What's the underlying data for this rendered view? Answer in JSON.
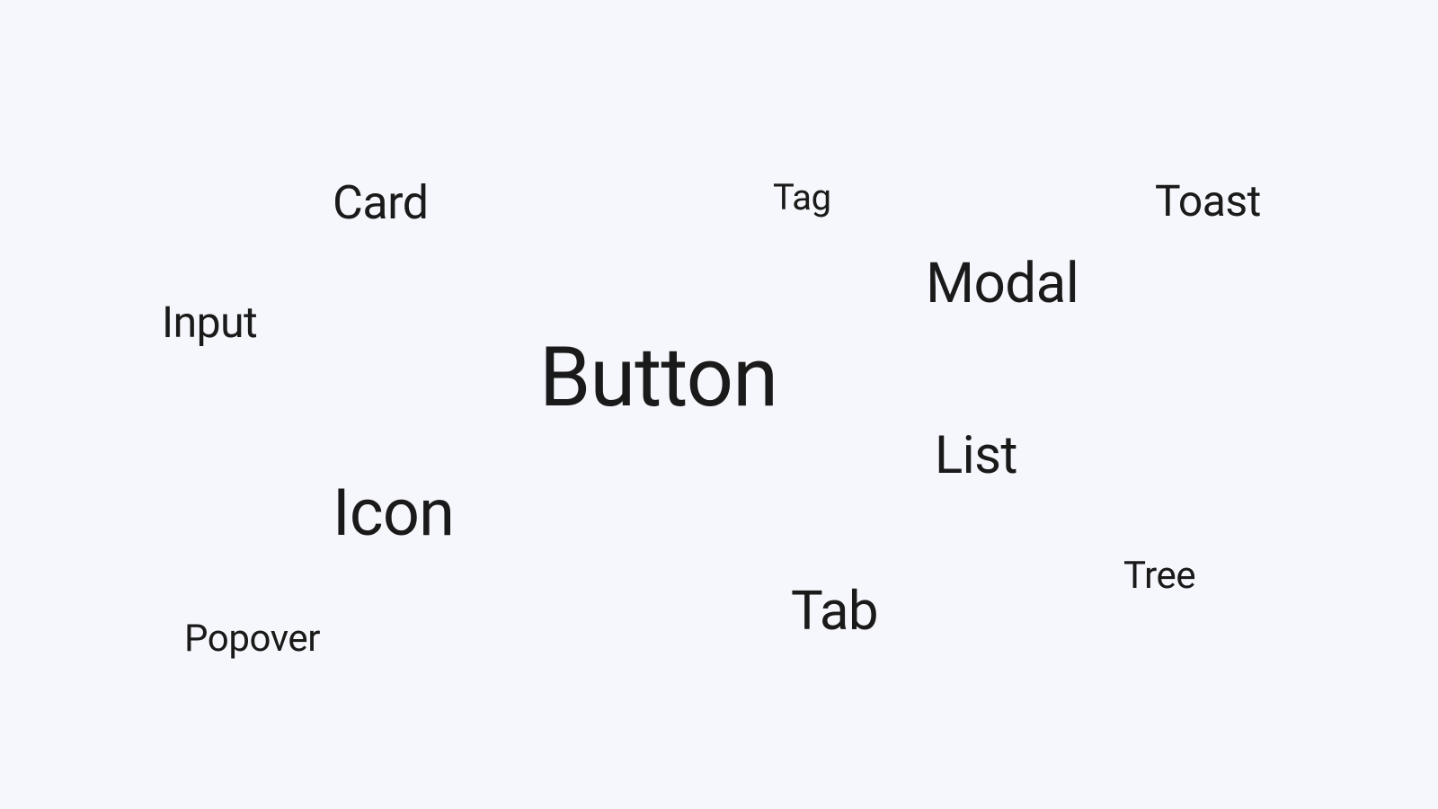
{
  "words": {
    "card": "Card",
    "tag": "Tag",
    "toast": "Toast",
    "modal": "Modal",
    "input": "Input",
    "button": "Button",
    "list": "List",
    "icon": "Icon",
    "tree": "Tree",
    "tab": "Tab",
    "popover": "Popover"
  }
}
